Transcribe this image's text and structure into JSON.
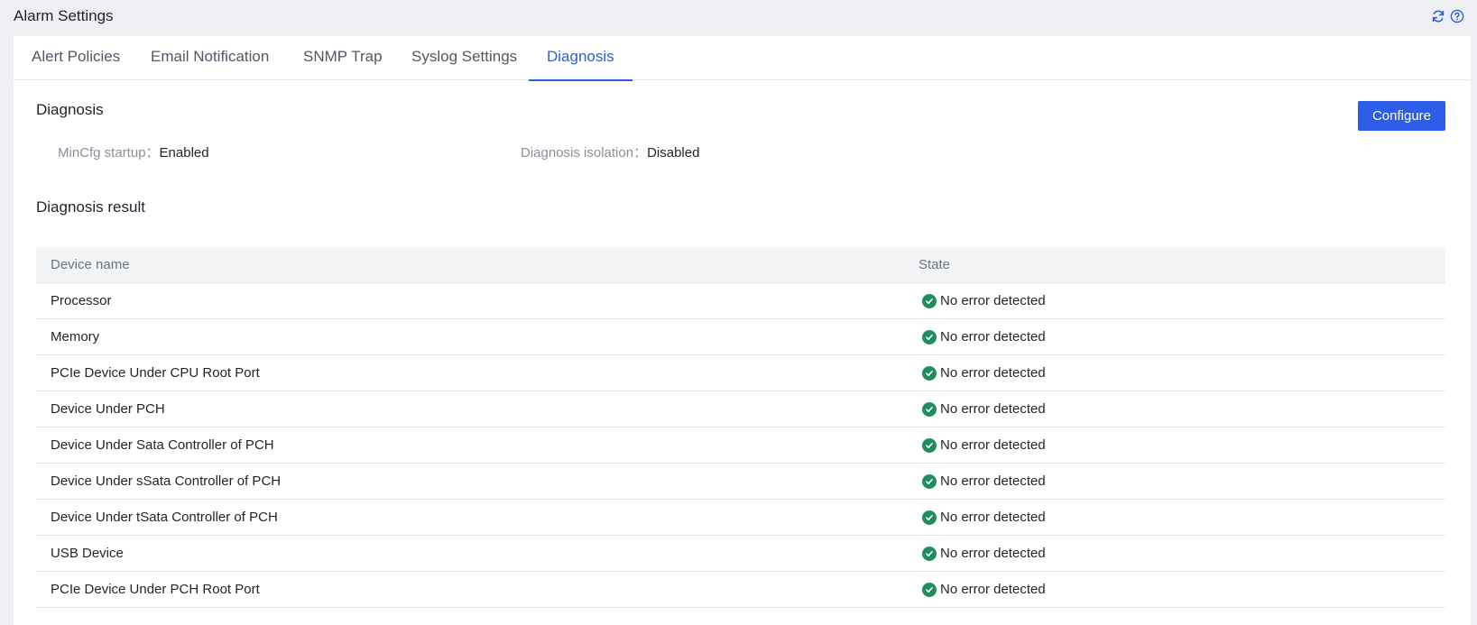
{
  "header": {
    "title": "Alarm Settings",
    "refresh_icon": "refresh-icon",
    "help_icon": "help-icon"
  },
  "tabs": [
    {
      "label": "Alert Policies",
      "active": false
    },
    {
      "label": "Email Notification",
      "active": false
    },
    {
      "label": "SNMP Trap",
      "active": false
    },
    {
      "label": "Syslog Settings",
      "active": false
    },
    {
      "label": "Diagnosis",
      "active": true
    }
  ],
  "diagnosis": {
    "title": "Diagnosis",
    "configure_label": "Configure",
    "mincfg_label": "MinCfg startup：",
    "mincfg_value": "Enabled",
    "isolation_label": "Diagnosis isolation：",
    "isolation_value": "Disabled"
  },
  "result": {
    "title": "Diagnosis result",
    "columns": [
      "Device name",
      "State"
    ],
    "rows": [
      {
        "device": "Processor",
        "state": "No error detected"
      },
      {
        "device": "Memory",
        "state": "No error detected"
      },
      {
        "device": "PCIe Device Under CPU Root Port",
        "state": "No error detected"
      },
      {
        "device": "Device Under PCH",
        "state": "No error detected"
      },
      {
        "device": "Device Under Sata Controller of PCH",
        "state": "No error detected"
      },
      {
        "device": "Device Under sSata Controller of PCH",
        "state": "No error detected"
      },
      {
        "device": "Device Under tSata Controller of PCH",
        "state": "No error detected"
      },
      {
        "device": "USB Device",
        "state": "No error detected"
      },
      {
        "device": "PCIe Device Under PCH Root Port",
        "state": "No error detected"
      }
    ]
  },
  "colors": {
    "accent": "#2d5fd8",
    "button": "#2d5ce6",
    "success": "#1f8f5f"
  }
}
